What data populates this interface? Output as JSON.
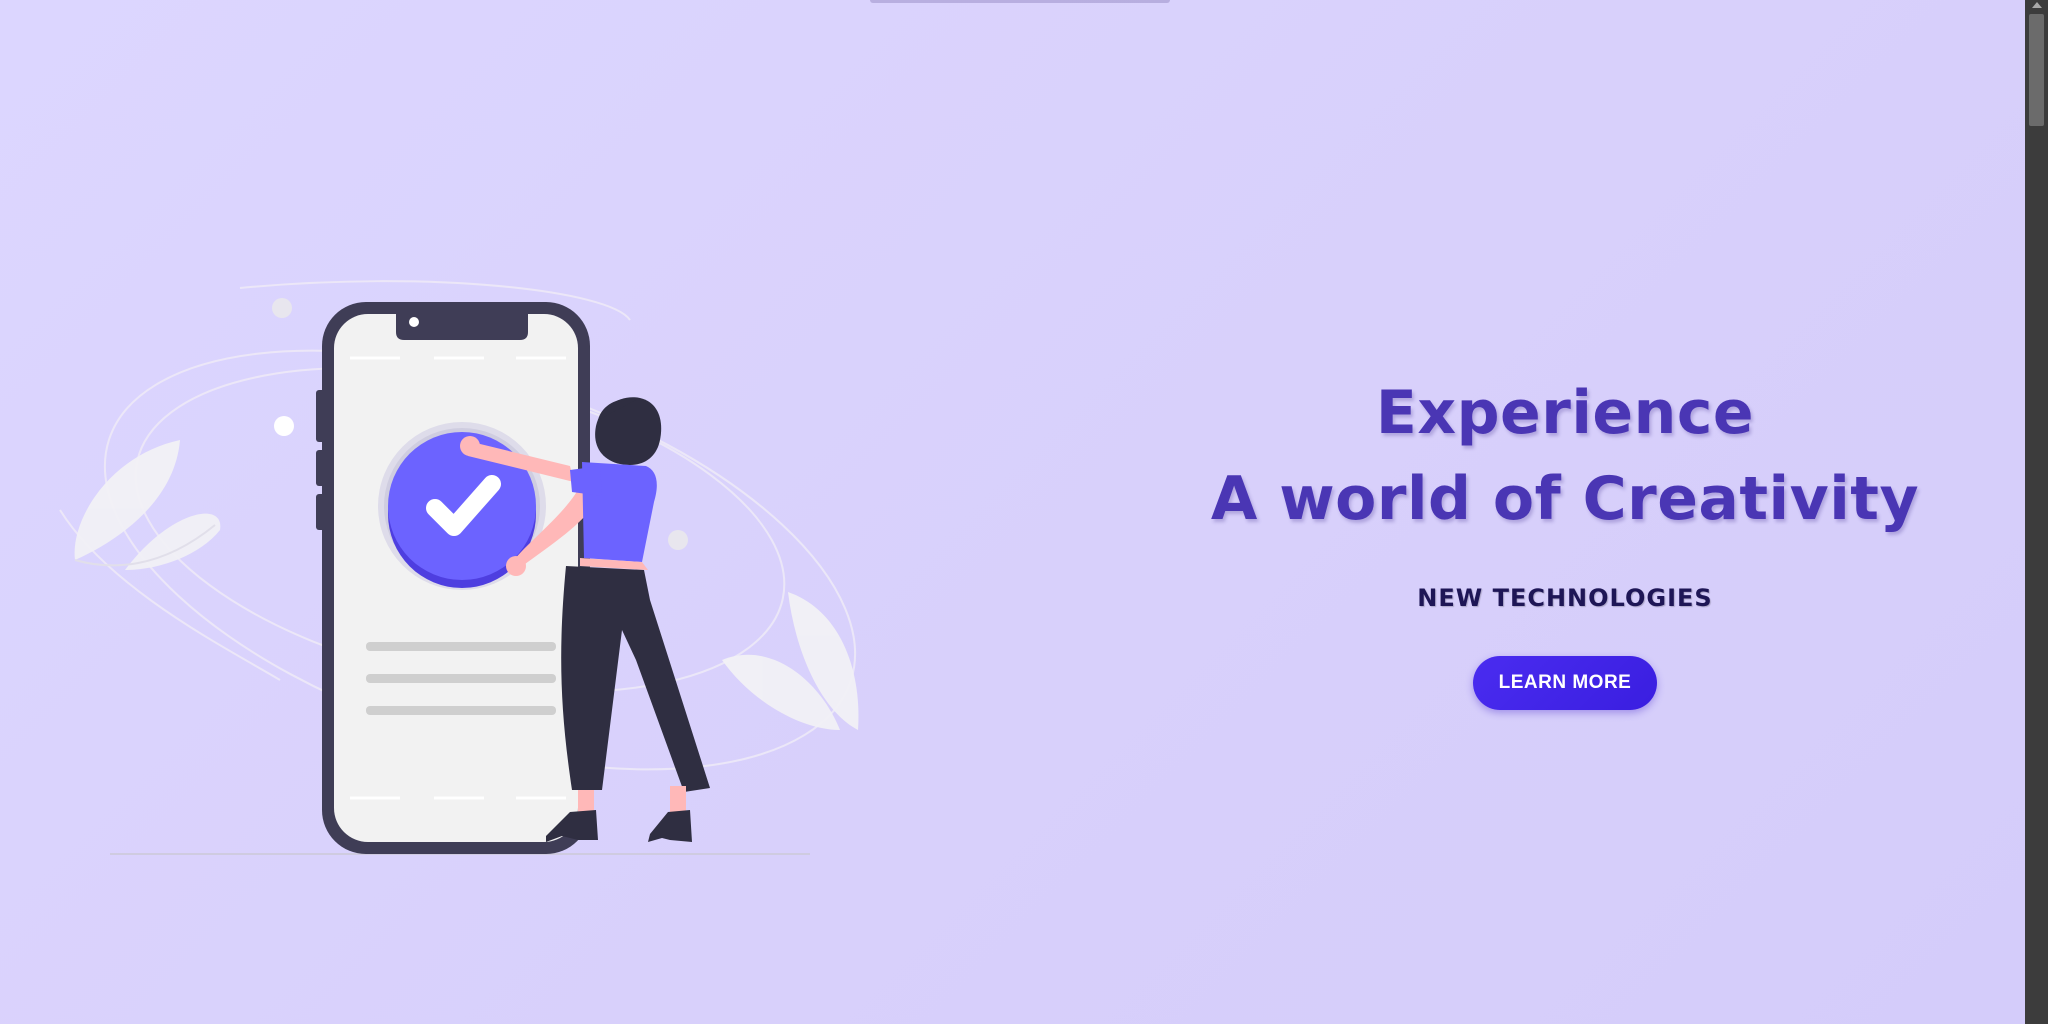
{
  "hero": {
    "headline_line1": "Experience",
    "headline_line2": "A world of Creativity",
    "subheading": "NEW TECHNOLOGIES",
    "cta_label": "LEARN MORE"
  },
  "illustration": {
    "icon": "phone-checkmark-person-illustration"
  },
  "colors": {
    "background": "#dcd6ff",
    "headline": "#4a36b4",
    "subheading": "#1e1656",
    "button": "#4a2cf0",
    "accent": "#6c63ff"
  }
}
